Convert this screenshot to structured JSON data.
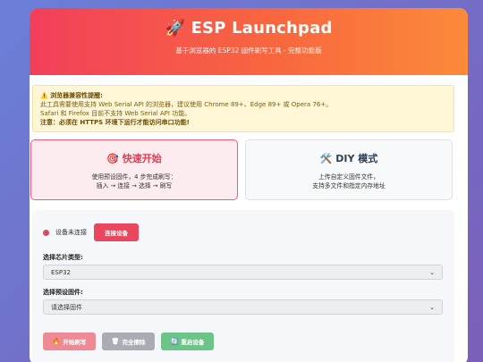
{
  "header": {
    "icon": "rocket-icon",
    "rocket_glyph": "🚀",
    "title": "ESP Launchpad",
    "subtitle": "基于浏览器的 ESP32 固件刷写工具 - 完整功能版"
  },
  "warning": {
    "icon": "warning-icon",
    "warning_glyph": "⚠️",
    "title": "浏览器兼容性提醒:",
    "line1": "此工具需要使用支持 Web Serial API 的浏览器，建议使用 Chrome 89+、Edge 89+ 或 Opera 76+。",
    "line2": "Safari 和 Firefox 目前不支持 Web Serial API 功能。",
    "note": "注意：必须在 HTTPS 环境下运行才能访问串口功能!"
  },
  "modes": {
    "quick": {
      "icon": "target-icon",
      "glyph": "🎯",
      "title": "快速开始",
      "desc1": "使用预设固件，4 步完成刷写：",
      "desc2": "插入 → 连接 → 选择 → 刷写"
    },
    "diy": {
      "icon": "tools-icon",
      "glyph": "🛠️",
      "title": "DIY 模式",
      "desc1": "上传自定义固件文件，",
      "desc2": "支持多文件和指定内存地址"
    }
  },
  "connection": {
    "status": "设备未连接",
    "status_color": "#e0485c",
    "connect_label": "连接设备"
  },
  "chip": {
    "label": "选择芯片类型:",
    "value": "ESP32"
  },
  "firmware": {
    "label": "选择预设固件:",
    "value": "请选择固件"
  },
  "actions": {
    "flash_label": "开始刷写",
    "flash_icon": "fire-icon",
    "erase_label": "完全擦除",
    "erase_icon": "trash-icon",
    "reset_label": "重启设备",
    "reset_icon": "refresh-icon"
  },
  "colors": {
    "accent": "#f23f5b",
    "background": "#7b5fb8"
  }
}
